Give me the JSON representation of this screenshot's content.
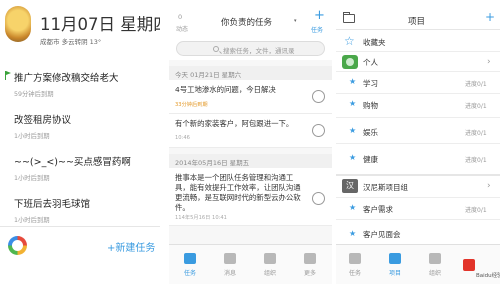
{
  "panel1": {
    "date": "11月07日 星期四",
    "weather": "成都市 多云转阴 13°",
    "tasks": [
      {
        "title": "推广方案修改稿交给老大",
        "meta": "59分钟后到期",
        "flagged": true
      },
      {
        "title": "改签租房协议",
        "meta": "1小时后到期",
        "flagged": false
      },
      {
        "title": "~~(>_<)~~买点感冒药啊",
        "meta": "1小时后到期",
        "flagged": false
      },
      {
        "title": "下班后去羽毛球馆",
        "meta": "1小时后到期",
        "flagged": false
      }
    ],
    "new_task": "+新建任务"
  },
  "panel2": {
    "dynamics_count": "0",
    "dynamics_label": "动态",
    "title": "你负责的任务",
    "caret": "▾",
    "new_label": "任务",
    "search_placeholder": "搜索任务，文件，通讯录",
    "groups": [
      {
        "date": "今天 01月21日 星期六",
        "tasks": [
          {
            "text": "4号工地渗水的问题，今日解决",
            "meta": "33分钟后到期",
            "meta_color": "orange"
          },
          {
            "text": "有个新的家装客户，阿包跟进一下。",
            "meta": "10:46",
            "meta_color": "gray"
          }
        ]
      },
      {
        "date": "2014年05月16日 星期五",
        "tasks": [
          {
            "text": "推事本是一个团队任务管理和沟通工具，能有效提升工作效率，让团队沟通更流畅，是互联网时代的新型云办公软件。",
            "meta": "114年5月16日 10:41",
            "meta_color": "gray"
          }
        ]
      }
    ],
    "tabs": [
      {
        "label": "任务",
        "active": true
      },
      {
        "label": "消息",
        "active": false
      },
      {
        "label": "组织",
        "active": false
      },
      {
        "label": "更多",
        "active": false
      }
    ]
  },
  "panel3": {
    "title": "项目",
    "plus": "+",
    "favorites_label": "收藏夹",
    "personal_label": "个人",
    "personal_items": [
      {
        "name": "学习",
        "progress": "进度0/1"
      },
      {
        "name": "购物",
        "progress": "进度0/1"
      },
      {
        "name": "娱乐",
        "progress": "进度0/1"
      },
      {
        "name": "健康",
        "progress": "进度0/1"
      }
    ],
    "group_label": "汉尼斯项目组",
    "group_icon_char": "汉",
    "group_items": [
      {
        "name": "客户需求",
        "progress": "进度0/1"
      },
      {
        "name": "客户见面会",
        "progress": ""
      }
    ],
    "watermark_text": "Baidu经验"
  },
  "colors": {
    "accent": "#3a9be0",
    "flag": "#3aa33a",
    "due_soon": "#e49a2a"
  }
}
